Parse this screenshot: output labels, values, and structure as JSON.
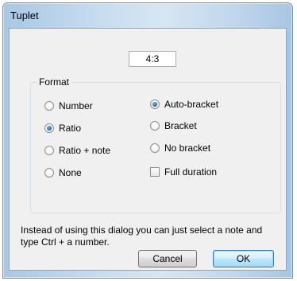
{
  "window": {
    "title": "Tuplet"
  },
  "ratio_field": {
    "value": "4:3"
  },
  "format_group": {
    "label": "Format",
    "number_options": [
      {
        "label": "Number",
        "checked": false
      },
      {
        "label": "Ratio",
        "checked": true
      },
      {
        "label": "Ratio + note",
        "checked": false
      },
      {
        "label": "None",
        "checked": false
      }
    ],
    "bracket_options": [
      {
        "label": "Auto-bracket",
        "checked": true
      },
      {
        "label": "Bracket",
        "checked": false
      },
      {
        "label": "No bracket",
        "checked": false
      }
    ],
    "full_duration": {
      "label": "Full duration",
      "checked": false
    }
  },
  "info_text": "Instead of using this dialog you can just select a note and type Ctrl + a number.",
  "buttons": {
    "cancel": "Cancel",
    "ok": "OK"
  },
  "colors": {
    "title_bar_glass": "#c4dbef",
    "client_bg": "#f0f0f0",
    "radio_dot": "#2a6bb7",
    "default_button_border": "#3c7fb1"
  }
}
